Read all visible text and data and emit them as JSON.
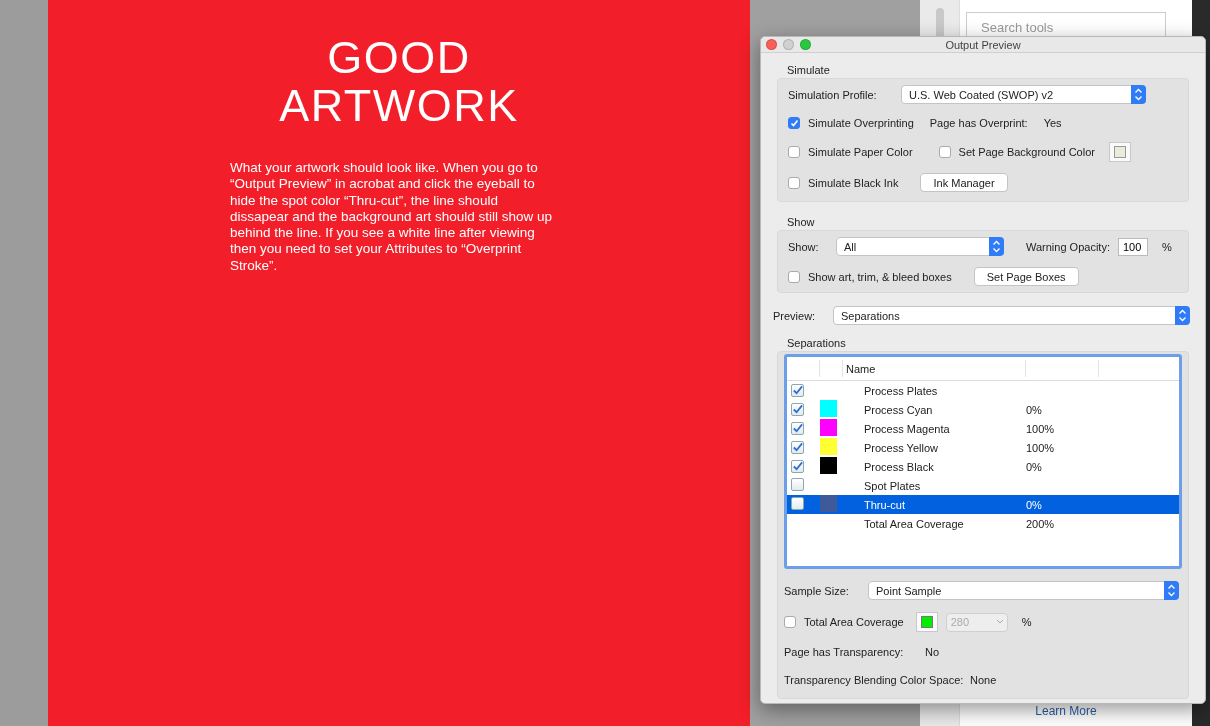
{
  "artwork": {
    "title_lines": [
      "GOOD",
      "ARTWORK"
    ],
    "body": "What your artwork should look like. When you go to “Output Preview” in acrobat and click the eyeball to hide the spot color “Thru-cut”, the line should dissapear and the background art should still show up behind the line. If you see a white line after viewing then you need to set your Attributes to “Overprint Stroke”."
  },
  "tools_panel": {
    "search": {
      "placeholder": "Search tools"
    },
    "link": "Learn More"
  },
  "dialog": {
    "title": "Output Preview",
    "simulate": {
      "heading": "Simulate",
      "profile_label": "Simulation Profile:",
      "profile_value": "U.S. Web Coated (SWOP) v2",
      "overprinting": {
        "label": "Simulate Overprinting",
        "checked": true
      },
      "overprint_label": "Page has Overprint:",
      "overprint_value": "Yes",
      "paper_color": {
        "label": "Simulate Paper Color",
        "checked": false
      },
      "background_color": {
        "label": "Set Page Background Color",
        "checked": false,
        "color": "#ecebd8"
      },
      "black_ink": {
        "label": "Simulate Black Ink",
        "checked": false
      },
      "ink_button": "Ink Manager"
    },
    "show": {
      "heading": "Show",
      "show_label": "Show:",
      "show_value": "All",
      "opacity_label": "Warning Opacity:",
      "opacity_value": "100",
      "percent": "%",
      "boxes": {
        "label": "Show art, trim, & bleed boxes",
        "checked": false
      },
      "boxes_button": "Set Page Boxes"
    },
    "preview": {
      "label": "Preview:",
      "value": "Separations"
    },
    "separations": {
      "heading": "Separations",
      "columns": [
        "Name"
      ],
      "rows": [
        {
          "name": "Process Plates",
          "checked": true,
          "selected": false
        },
        {
          "name": "Process Cyan",
          "checked": true,
          "color": "#00ffff",
          "coverage": "0%",
          "selected": false
        },
        {
          "name": "Process Magenta",
          "checked": true,
          "color": "#ff00ff",
          "coverage": "100%",
          "selected": false
        },
        {
          "name": "Process Yellow",
          "checked": true,
          "color": "#ffff33",
          "coverage": "100%",
          "selected": false
        },
        {
          "name": "Process Black",
          "checked": true,
          "color": "#000000",
          "coverage": "0%",
          "selected": false
        },
        {
          "name": "Spot Plates",
          "checked": false,
          "selected": false
        },
        {
          "name": "Thru-cut",
          "checked": false,
          "color": "#3f5a9a",
          "coverage": "0%",
          "selected": true
        },
        {
          "name": "Total Area Coverage",
          "coverage": "200%",
          "selected": false
        }
      ],
      "sample_label": "Sample Size:",
      "sample_value": "Point Sample",
      "coverage": {
        "label": "Total Area Coverage",
        "checked": false,
        "color": "#00ee00",
        "value": "280",
        "percent": "%"
      },
      "transparency_label": "Page has Transparency:",
      "transparency_value": "No",
      "blending_label": "Transparency Blending Color Space:",
      "blending_value": "None"
    }
  }
}
